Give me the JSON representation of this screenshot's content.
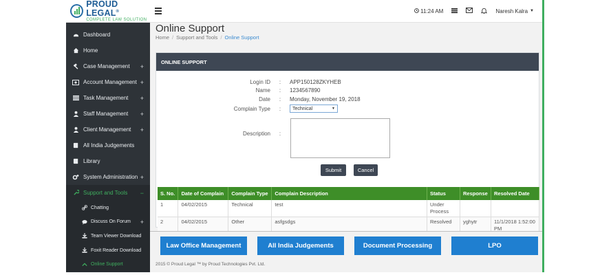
{
  "brand": {
    "name": "PROUD LEGAL",
    "registered": "®",
    "tagline": "COMPLETE LAW SOLUTION"
  },
  "sidebar": {
    "items": [
      {
        "label": "Dashboard",
        "icon": "dashboard-icon",
        "expandable": false
      },
      {
        "label": "Home",
        "icon": "home-icon",
        "expandable": false
      },
      {
        "label": "Case Management",
        "icon": "gavel-icon",
        "expandable": true,
        "toggle": "+"
      },
      {
        "label": "Account Management",
        "icon": "money-icon",
        "expandable": true,
        "toggle": "+"
      },
      {
        "label": "Task Management",
        "icon": "tasks-icon",
        "expandable": true,
        "toggle": "+"
      },
      {
        "label": "Staff Management",
        "icon": "user-icon",
        "expandable": true,
        "toggle": "+"
      },
      {
        "label": "Client Management",
        "icon": "user-icon",
        "expandable": true,
        "toggle": "+"
      },
      {
        "label": "All India Judgements",
        "icon": "book-icon",
        "expandable": false
      },
      {
        "label": "Library",
        "icon": "book-icon",
        "expandable": false
      },
      {
        "label": "System Administration",
        "icon": "cogs-icon",
        "expandable": true,
        "toggle": "+"
      },
      {
        "label": "Support and Tools",
        "icon": "tools-icon",
        "expandable": true,
        "toggle": "−",
        "active": true
      }
    ],
    "subitems": [
      {
        "label": "Chatting",
        "icon": "link-icon"
      },
      {
        "label": "Discuss On Forum",
        "icon": "comment-icon",
        "toggle": "+"
      },
      {
        "label": "Team Viewer Download",
        "icon": "download-icon"
      },
      {
        "label": "Foxit Reader Download",
        "icon": "download-icon"
      },
      {
        "label": "Online Support",
        "icon": "support-icon",
        "active": true
      }
    ]
  },
  "topbar": {
    "time": "11:24 AM",
    "user": "Naresh Kalra"
  },
  "page": {
    "title": "Online Support",
    "breadcrumb": [
      "Home",
      "Support and Tools",
      "Online Support"
    ],
    "panel_title": "ONLINE SUPPORT"
  },
  "form": {
    "login_id": {
      "label": "Login ID",
      "value": "APP150128ZKYHEB"
    },
    "name": {
      "label": "Name",
      "value": "1234567890"
    },
    "date": {
      "label": "Date",
      "value": "Monday, November 19, 2018"
    },
    "complain_type": {
      "label": "Complain Type",
      "value": "Technical"
    },
    "description": {
      "label": "Description",
      "value": ""
    },
    "colon": ":",
    "submit_label": "Submit",
    "cancel_label": "Cancel"
  },
  "table": {
    "headers": [
      "S. No.",
      "Date of Complain",
      "Complain Type",
      "Complain Description",
      "Status",
      "Response",
      "Resolved Date"
    ],
    "rows": [
      [
        "1",
        "04/02/2015",
        "Technical",
        "test",
        "Under Process",
        "",
        ""
      ],
      [
        "2",
        "04/02/2015",
        "Other",
        "asfgsdgs",
        "Resolved",
        "yghytr",
        "11/1/2018 1:52:00 PM"
      ]
    ]
  },
  "footer": {
    "buttons": [
      "Law Office Management",
      "All India Judgements",
      "Document Processing",
      "LPO"
    ],
    "copyright": "2015 © Proud Legal ™ by Proud Technologies Pvt. Ltd."
  },
  "colors": {
    "sidebar": "#2e3338",
    "panel_header": "#3e4754",
    "table_header": "#3e8e28",
    "active": "#3fae5f",
    "footer_button": "#1f7fd0"
  }
}
